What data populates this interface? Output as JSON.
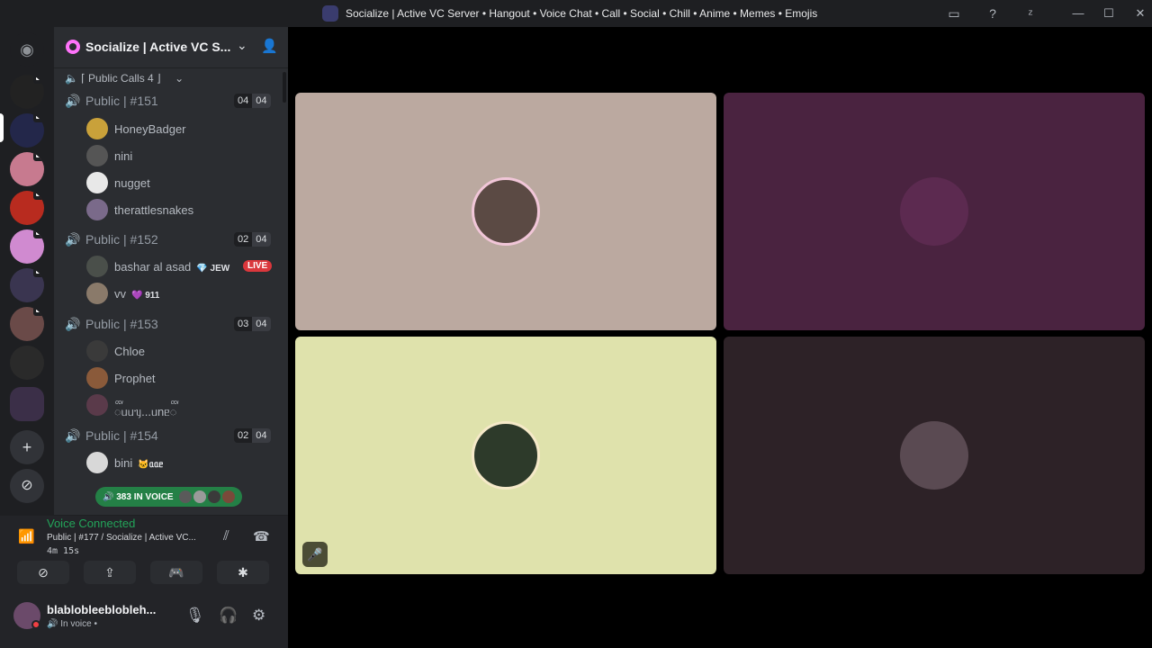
{
  "window": {
    "title": "Socialize | Active VC Server • Hangout • Voice Chat • Call • Social • Chill • Anime • Memes • Emojis"
  },
  "server": {
    "name": "Socialize | Active VC S...",
    "category": "⌈ Public Calls 4 ⌋"
  },
  "channels": [
    {
      "name": "Public | #151",
      "count": "04",
      "limit": "04",
      "users": [
        {
          "name": "HoneyBadger"
        },
        {
          "name": "nini"
        },
        {
          "name": "nugget"
        },
        {
          "name": "therattlesnakes"
        }
      ]
    },
    {
      "name": "Public | #152",
      "count": "02",
      "limit": "04",
      "users": [
        {
          "name": "bashar al asad",
          "tag": "💎 JEW",
          "live": "LIVE"
        },
        {
          "name": "vv",
          "tag": "💜 911"
        }
      ]
    },
    {
      "name": "Public | #153",
      "count": "03",
      "limit": "04",
      "users": [
        {
          "name": "Chloe"
        },
        {
          "name": "Prophet"
        },
        {
          "name": "ᢅᥙᥙᥡ...ᥙnᥱᢅ"
        }
      ]
    },
    {
      "name": "Public | #154",
      "count": "02",
      "limit": "04",
      "users": [
        {
          "name": "bini",
          "tag": "🐱ᥲᥲᥱ"
        }
      ]
    }
  ],
  "in_voice_pill": "🔊 383 IN VOICE",
  "voice_panel": {
    "status": "Voice Connected",
    "channel": "Public | #177 / Socialize | Active VC...",
    "elapsed": "4m 15s"
  },
  "user_panel": {
    "name": "blablobleeblobleh...",
    "status": "In voice •"
  },
  "colors": {
    "tile1": "#bba9a0",
    "tile2": "#4a2340",
    "tile3": "#dfe2ac",
    "tile4": "#2d2227",
    "accent_green": "#23a55a"
  }
}
